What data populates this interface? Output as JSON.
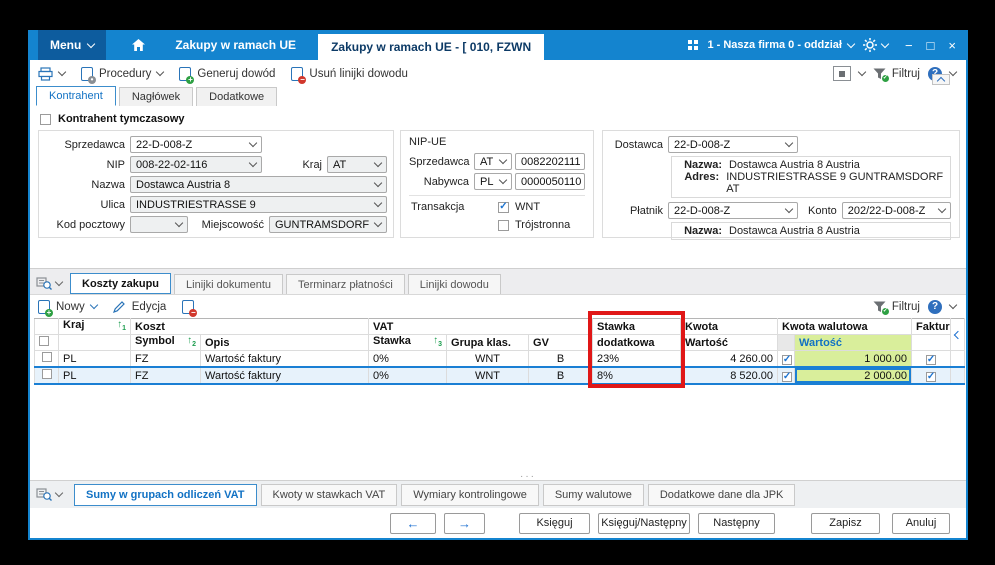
{
  "titlebar": {
    "menu": "Menu",
    "tab_background": "Zakupy w ramach UE",
    "tab_active": "Zakupy w ramach UE - [ 010, FZWN",
    "company": "1 - Nasza firma 0 - oddział",
    "window_controls": {
      "minimize": "−",
      "maximize": "□",
      "close": "×"
    }
  },
  "toolbar": {
    "procedury": "Procedury",
    "generuj_dowod": "Generuj dowód",
    "usun_linijki": "Usuń linijki dowodu",
    "filtruj": "Filtruj",
    "help": "?"
  },
  "main_tabs": {
    "kontrahent": "Kontrahent",
    "naglowek": "Nagłówek",
    "dodatkowe": "Dodatkowe"
  },
  "kontrahent_form": {
    "tymczasowy_label": "Kontrahent tymczasowy",
    "sprzedawca_label": "Sprzedawca",
    "sprzedawca_value": "22-D-008-Z",
    "nip_label": "NIP",
    "nip_value": "008-22-02-116",
    "kraj_label": "Kraj",
    "kraj_value": "AT",
    "nazwa_label": "Nazwa",
    "nazwa_value": "Dostawca Austria 8",
    "ulica_label": "Ulica",
    "ulica_value": "INDUSTRIESTRASSE 9",
    "kod_pocztowy_label": "Kod pocztowy",
    "kod_pocztowy_value": "",
    "miejscowosc_label": "Miejscowość",
    "miejscowosc_value": "GUNTRAMSDORF"
  },
  "nip_ue": {
    "title": "NIP-UE",
    "sprzedawca_label": "Sprzedawca",
    "sprzedawca_prefix": "AT",
    "sprzedawca_value": "0082202111",
    "nabywca_label": "Nabywca",
    "nabywca_prefix": "PL",
    "nabywca_value": "0000050110",
    "transakcja_label": "Transakcja",
    "wnt_label": "WNT",
    "trojstronna_label": "Trójstronna"
  },
  "dostawca_panel": {
    "dostawca_label": "Dostawca",
    "dostawca_value": "22-D-008-Z",
    "nazwa_label": "Nazwa:",
    "nazwa_value": "Dostawca Austria 8 Austria",
    "adres_label": "Adres:",
    "adres_value": "INDUSTRIESTRASSE 9  GUNTRAMSDORF  AT",
    "platnik_label": "Płatnik",
    "platnik_value": "22-D-008-Z",
    "konto_label": "Konto",
    "konto_value": "202/22-D-008-Z",
    "platnik_nazwa_label": "Nazwa:",
    "platnik_nazwa_value": "Dostawca Austria 8 Austria"
  },
  "grid_tabs": {
    "koszty": "Koszty zakupu",
    "linijki_dokumentu": "Linijki dokumentu",
    "terminarz": "Terminarz płatności",
    "linijki_dowodu": "Linijki dowodu"
  },
  "grid_toolbar": {
    "nowy": "Nowy",
    "edycja": "Edycja",
    "filtruj": "Filtruj"
  },
  "grid": {
    "headers": {
      "kraj": "Kraj",
      "koszt": "Koszt",
      "symbol": "Symbol",
      "opis": "Opis",
      "vat": "VAT",
      "stawka": "Stawka",
      "grupa_klas": "Grupa klas.",
      "gv": "GV",
      "stawka_dodatkowa_1": "Stawka",
      "stawka_dodatkowa_2": "dodatkowa",
      "kwota": "Kwota",
      "wartosc": "Wartość",
      "kwota_walutowa": "Kwota walutowa",
      "wartosc_walutowa": "Wartość",
      "faktura": "Faktura"
    },
    "rows": [
      {
        "kraj": "PL",
        "symbol": "FZ",
        "opis": "Wartość faktury",
        "stawka": "0%",
        "grupa_klas": "WNT",
        "gv": "B",
        "stawka_dodatkowa": "23%",
        "kwota_wartosc": "4 260.00",
        "kwota_walutowa_wartosc": "1 000.00"
      },
      {
        "kraj": "PL",
        "symbol": "FZ",
        "opis": "Wartość faktury",
        "stawka": "0%",
        "grupa_klas": "WNT",
        "gv": "B",
        "stawka_dodatkowa": "8%",
        "kwota_wartosc": "8 520.00",
        "kwota_walutowa_wartosc": "2 000.00"
      }
    ]
  },
  "bottom_tabs": {
    "sumy_grupy": "Sumy w grupach odliczeń VAT",
    "kwoty_stawki": "Kwoty w stawkach VAT",
    "wymiary": "Wymiary kontrolingowe",
    "sumy_walutowe": "Sumy walutowe",
    "dodatkowe_jpk": "Dodatkowe dane dla JPK"
  },
  "footer": {
    "prev": "←",
    "next": "→",
    "ksieguj": "Księguj",
    "ksieguj_nastepny": "Księguj/Następny",
    "nastepny": "Następny",
    "zapisz": "Zapisz",
    "anuluj": "Anuluj"
  },
  "colors": {
    "titlebar": "#1484cf",
    "menu_button": "#0d5c9e",
    "accent": "#1a7fd4",
    "selected_row": "#e7f2fb",
    "currency_cell": "#d9ee9b",
    "annotation": "#e01717"
  }
}
